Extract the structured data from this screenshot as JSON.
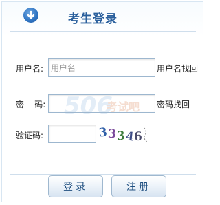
{
  "header": {
    "title": "考生登录",
    "icon": "arrow-down-circle-icon",
    "accent": "#2a5f9c"
  },
  "form": {
    "username": {
      "label": "用户名:",
      "placeholder": "用户名",
      "value": "",
      "link": "用户名找回"
    },
    "password": {
      "label": "密    码:",
      "value": "",
      "link": "密码找回"
    },
    "captcha": {
      "label": "验证码:",
      "value": "",
      "code": [
        "3",
        "3",
        "3",
        "4",
        "6"
      ]
    }
  },
  "watermark": {
    "brand": "506",
    "text": "考试吧"
  },
  "buttons": {
    "login_label": "登录",
    "register_label": "注册"
  }
}
